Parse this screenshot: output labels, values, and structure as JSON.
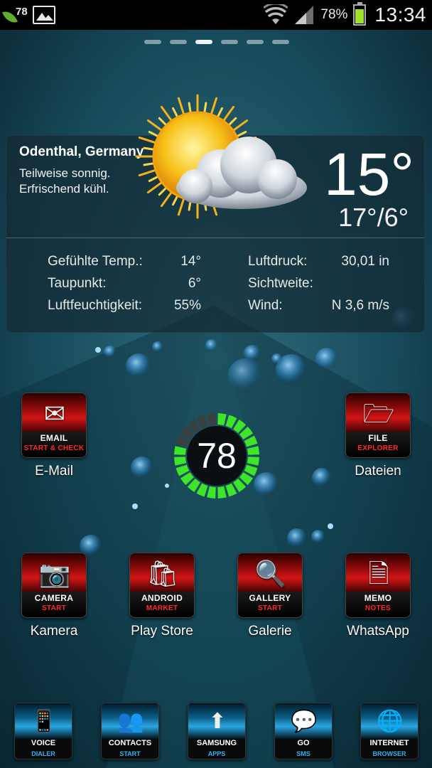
{
  "status_bar": {
    "notification_count": "78",
    "battery_percent": "78%",
    "time": "13:34",
    "icons": [
      "leaf-icon",
      "image-icon",
      "wifi-icon",
      "signal-icon",
      "battery-icon"
    ]
  },
  "home": {
    "page_count": 6,
    "active_page": 2
  },
  "weather": {
    "city": "Odenthal, Germany",
    "condition_line1": "Teilweise sonnig.",
    "condition_line2": "Erfrischend kühl.",
    "temperature": "15°",
    "high_low": "17°/6°",
    "icon": "partly-cloudy-sun-icon",
    "details_left": [
      {
        "label": "Gefühlte Temp.:",
        "value": "14°"
      },
      {
        "label": "Taupunkt:",
        "value": "6°"
      },
      {
        "label": "Luftfeuchtigkeit:",
        "value": "55%"
      }
    ],
    "details_right": [
      {
        "label": "Luftdruck:",
        "value": "30,01 in"
      },
      {
        "label": "Sichtweite:",
        "value": ""
      },
      {
        "label": "Wind:",
        "value": "N 3,6 m/s"
      }
    ]
  },
  "battery_widget": {
    "level": 78,
    "level_text": "78",
    "color": "#3ee62a"
  },
  "apps": [
    {
      "label": "E-Mail",
      "icon": "email-icon",
      "tile_title": "EMAIL",
      "tile_sub": "START & CHECK"
    },
    {
      "label": "Dateien",
      "icon": "folder-icon",
      "tile_title": "FILE",
      "tile_sub": "EXPLORER"
    },
    {
      "label": "Kamera",
      "icon": "camera-icon",
      "tile_title": "CAMERA",
      "tile_sub": "START"
    },
    {
      "label": "Play Store",
      "icon": "android-market-icon",
      "tile_title": "ANDROID",
      "tile_sub": "MARKET"
    },
    {
      "label": "Galerie",
      "icon": "gallery-icon",
      "tile_title": "GALLERY",
      "tile_sub": "START"
    },
    {
      "label": "WhatsApp",
      "icon": "memo-icon",
      "tile_title": "MEMO",
      "tile_sub": "NOTES"
    }
  ],
  "dock": [
    {
      "icon": "voice-dialer-icon",
      "title": "VOICE",
      "sub": "DIALER"
    },
    {
      "icon": "contacts-icon",
      "title": "CONTACTS",
      "sub": "START"
    },
    {
      "icon": "samsung-apps-icon",
      "title": "SAMSUNG",
      "sub": "APPS"
    },
    {
      "icon": "go-sms-icon",
      "title": "GO",
      "sub": "SMS"
    },
    {
      "icon": "internet-browser-icon",
      "title": "INTERNET",
      "sub": "BROWSER"
    }
  ],
  "colors": {
    "tile_accent": "#d11515",
    "dock_accent": "#2aa7e2",
    "battery_fill": "#9ee22b"
  }
}
